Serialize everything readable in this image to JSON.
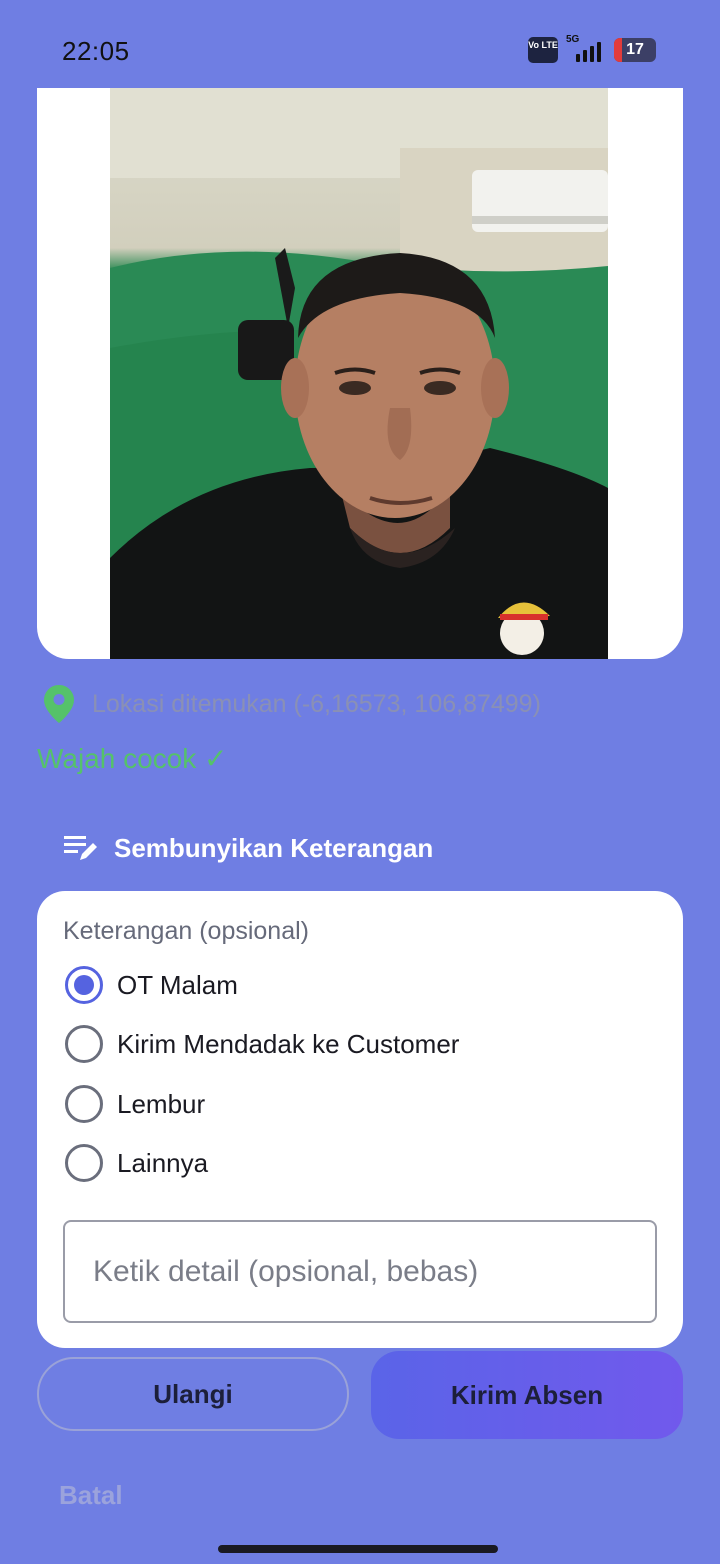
{
  "status_bar": {
    "time": "22:05",
    "volte": "Vo LTE",
    "network": "5G",
    "battery": "17"
  },
  "location": {
    "icon": "map-pin-icon",
    "text": "Lokasi ditemukan (-6,16573, 106,87499)"
  },
  "face_match": {
    "text": "Wajah cocok ✓"
  },
  "notes_toggle": {
    "icon": "notes-edit-icon",
    "label": "Sembunyikan Keterangan"
  },
  "notes": {
    "title": "Keterangan (opsional)",
    "options": [
      {
        "label": "OT Malam",
        "selected": true
      },
      {
        "label": "Kirim Mendadak ke Customer",
        "selected": false
      },
      {
        "label": "Lembur",
        "selected": false
      },
      {
        "label": "Lainnya",
        "selected": false
      }
    ],
    "detail_placeholder": "Ketik detail (opsional, bebas)",
    "detail_value": ""
  },
  "actions": {
    "retry_label": "Ulangi",
    "submit_label": "Kirim Absen",
    "cancel_label": "Batal"
  },
  "colors": {
    "background": "#6f7ee3",
    "accent": "#5563e0",
    "success": "#55c26a"
  }
}
